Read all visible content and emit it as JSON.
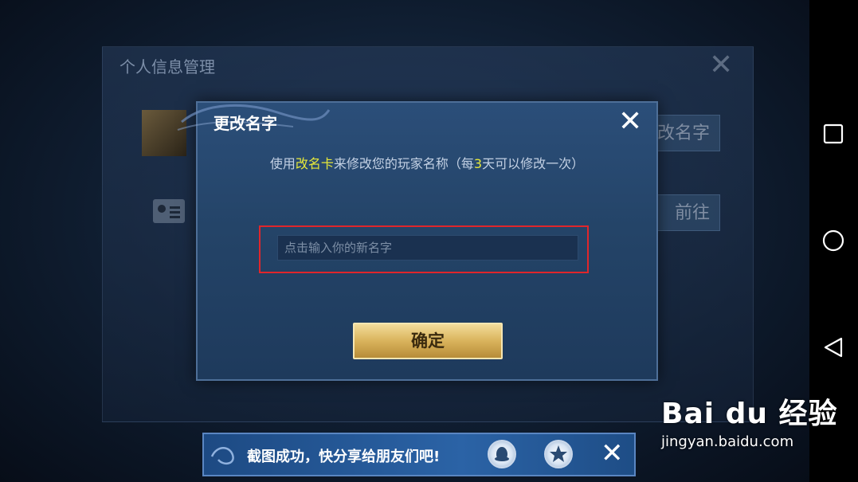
{
  "background_panel": {
    "title": "个人信息管理",
    "close_glyph": "✕",
    "button_rename": "改名字",
    "button_goto": "前往"
  },
  "dialog": {
    "title": "更改名字",
    "close_glyph": "✕",
    "description": {
      "part1": "使用",
      "highlight1": "改名卡",
      "part2": "来修改您的玩家名称（每",
      "highlight2": "3",
      "part3": "天可以修改一次）"
    },
    "input_placeholder": "点击输入你的新名字",
    "input_value": "",
    "confirm_label": "确定"
  },
  "share_bar": {
    "message": "截图成功，快分享给朋友们吧!",
    "icons": [
      "qq-icon",
      "qzone-star-icon"
    ],
    "close_glyph": "✕"
  },
  "nav_bar": {
    "buttons": [
      "recent-apps-icon",
      "home-icon",
      "back-icon"
    ]
  },
  "watermark": {
    "logo": "Bai du 经验",
    "url": "jingyan.baidu.com"
  },
  "colors": {
    "highlight_text": "#e6e83a",
    "annotation_box": "#e0262b",
    "confirm_button": "#d9b35c",
    "dialog_bg": "#244468"
  }
}
